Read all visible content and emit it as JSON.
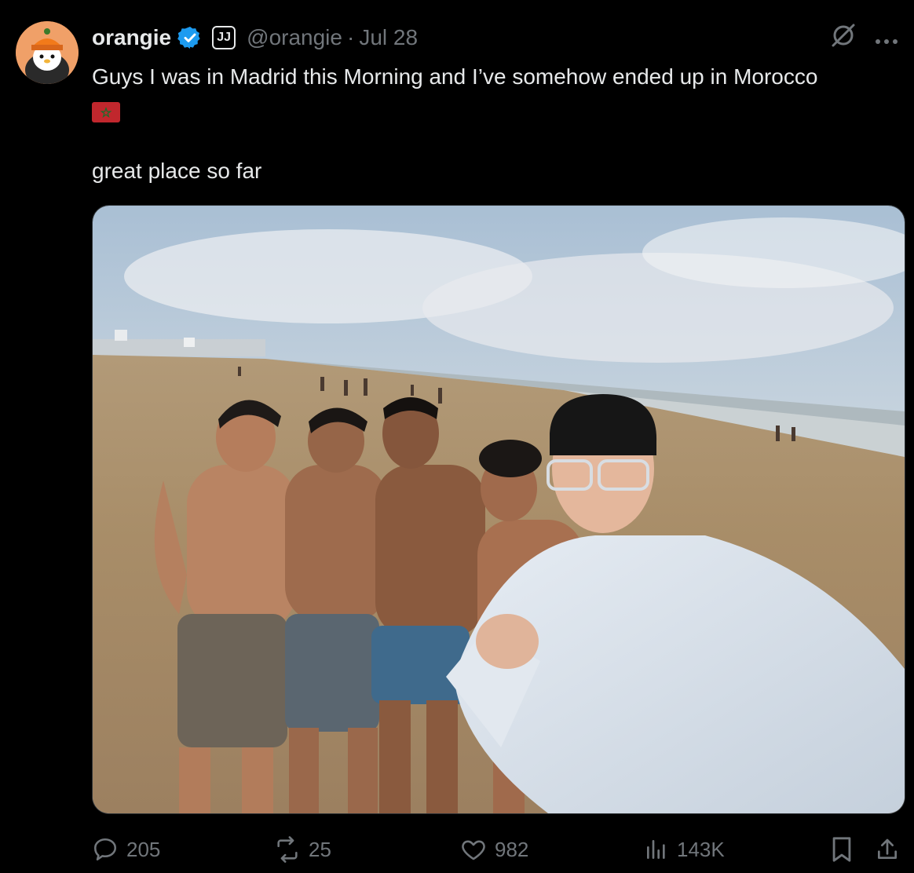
{
  "author": {
    "name": "orangie",
    "handle": "@orangie",
    "separator": "·",
    "date": "Jul 28",
    "affiliate_badge": "JJ"
  },
  "tweet": {
    "line1": "Guys I was in Madrid this Morning and I’ve somehow ended up in Morocco",
    "flag_icon": "morocco-flag-icon",
    "line2": "great place so far"
  },
  "media": {
    "photo_icon": "beach-selfie-photo"
  },
  "actions": {
    "replies": "205",
    "reposts": "25",
    "likes": "982",
    "views": "143K"
  },
  "colors": {
    "background": "#000000",
    "text": "#e7e9ea",
    "muted": "#71767b",
    "verified": "#1d9bf0",
    "avatar": "#f08a4b"
  }
}
